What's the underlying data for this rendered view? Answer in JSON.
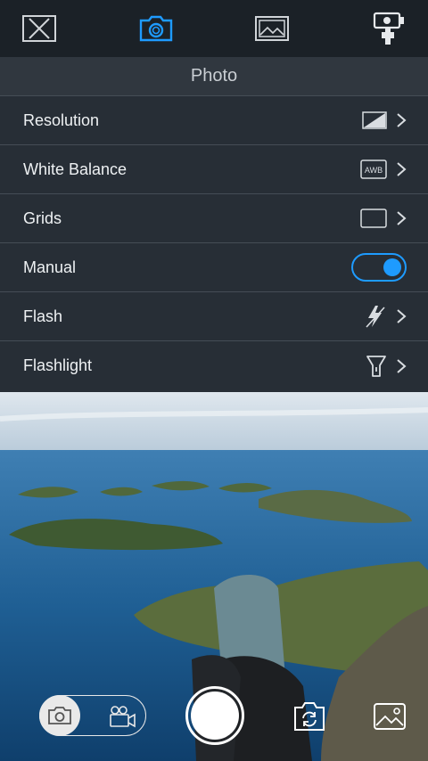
{
  "toolbar": {
    "items": [
      {
        "icon": "close-x-icon"
      },
      {
        "icon": "camera-icon",
        "active": true
      },
      {
        "icon": "image-icon"
      },
      {
        "icon": "gimbal-icon"
      }
    ],
    "accent_color": "#1e9bff"
  },
  "panel": {
    "title": "Photo",
    "rows": [
      {
        "label": "Resolution",
        "icon": "resolution-icon"
      },
      {
        "label": "White Balance",
        "icon": "awb-icon",
        "icon_text": "AWB"
      },
      {
        "label": "Grids",
        "icon": "grid-frame-icon"
      },
      {
        "label": "Manual",
        "control": "toggle",
        "on": true
      },
      {
        "label": "Flash",
        "icon": "flash-off-icon"
      },
      {
        "label": "Flashlight",
        "icon": "flashlight-icon"
      }
    ]
  },
  "bottom": {
    "mode_selected": "photo",
    "modes": [
      "photo",
      "video"
    ]
  }
}
